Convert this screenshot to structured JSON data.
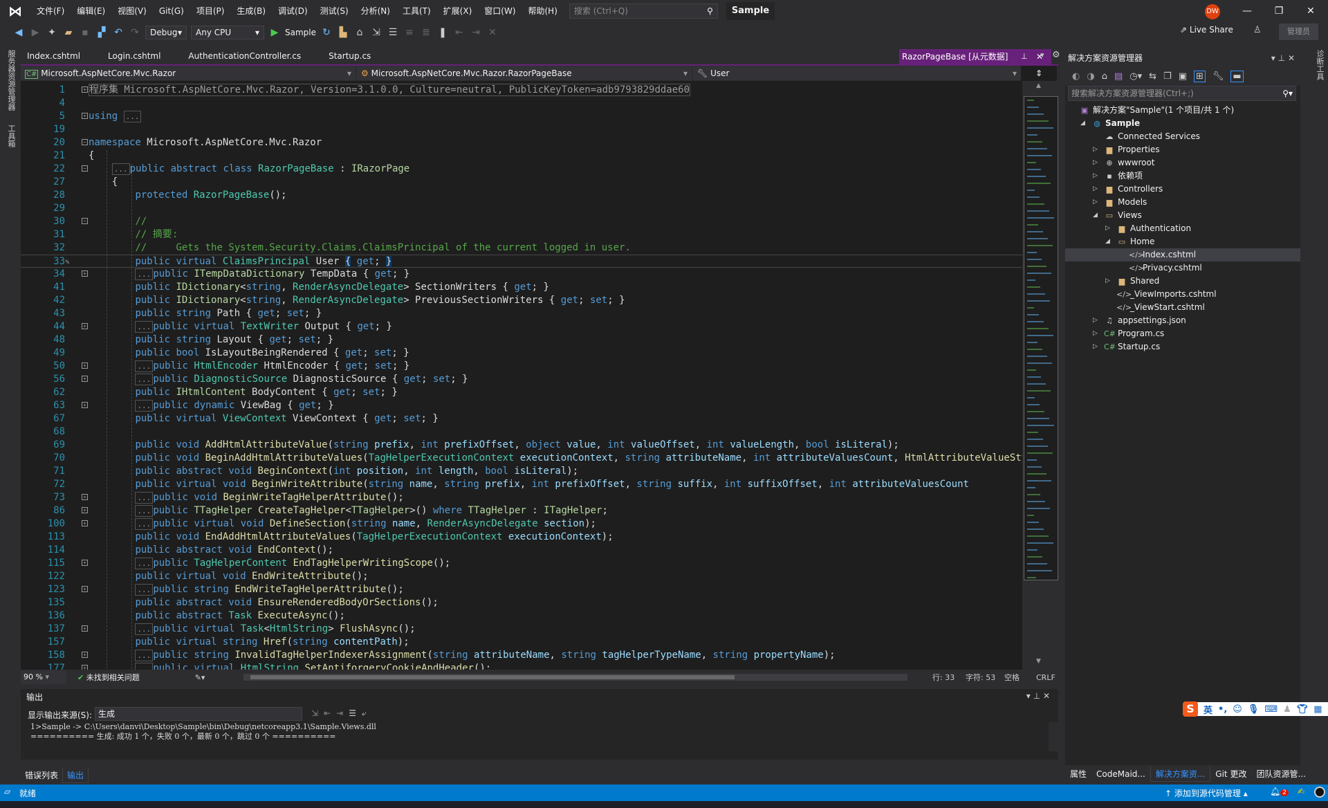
{
  "titlebar": {
    "menus": [
      "文件(F)",
      "编辑(E)",
      "视图(V)",
      "Git(G)",
      "项目(P)",
      "生成(B)",
      "调试(D)",
      "测试(S)",
      "分析(N)",
      "工具(T)",
      "扩展(X)",
      "窗口(W)",
      "帮助(H)"
    ],
    "search_placeholder": "搜索 (Ctrl+Q)",
    "solution_name": "Sample",
    "avatar_initials": "DW",
    "minimize": "—",
    "restore": "❐",
    "close": "✕"
  },
  "toolbar": {
    "configuration": "Debug",
    "platform": "Any CPU",
    "run_target": "Sample",
    "live_share": "Live Share",
    "admin_badge": "管理员"
  },
  "left_strip": {
    "tabs": [
      "服务器资源管理器",
      "工具箱"
    ]
  },
  "right_strip": {
    "tabs": [
      "诊断工具"
    ]
  },
  "editor": {
    "tabs": [
      "Index.cshtml",
      "Login.cshtml",
      "AuthenticationController.cs",
      "Startup.cs"
    ],
    "active_tab": "RazorPageBase [从元数据]",
    "nav": {
      "project": "Microsoft.AspNetCore.Mvc.Razor",
      "type": "Microsoft.AspNetCore.Mvc.Razor.RazorPageBase",
      "member": "User"
    },
    "lines": [
      {
        "n": "1",
        "fold": "+",
        "html": "<span class='gr' style='border:1px solid #555'>程序集 Microsoft.AspNetCore.Mvc.Razor, Version=3.1.0.0, Culture=neutral, PublicKeyToken=adb9793829ddae60</span>"
      },
      {
        "n": "4",
        "html": ""
      },
      {
        "n": "5",
        "fold": "+",
        "html": "<span class='kw'>using</span> <span class='coll'>...</span>"
      },
      {
        "n": "19",
        "html": ""
      },
      {
        "n": "20",
        "fold": "-",
        "html": "<span class='kw'>namespace</span> <span class='tx'>Microsoft.AspNetCore.Mvc.Razor</span>"
      },
      {
        "n": "21",
        "html": "<span class='tx'>{</span>"
      },
      {
        "n": "22",
        "fold": "-",
        "html": "    <span class='coll'>...</span><span class='kw'>public abstract class</span> <span class='ty'>RazorPageBase</span> <span class='tx'>:</span> <span class='if'>IRazorPage</span>"
      },
      {
        "n": "27",
        "html": "    <span class='tx'>{</span>"
      },
      {
        "n": "28",
        "html": "        <span class='kw'>protected</span> <span class='ty'>RazorPageBase</span><span class='tx'>();</span>"
      },
      {
        "n": "29",
        "html": ""
      },
      {
        "n": "30",
        "fold": "-",
        "html": "        <span class='cm'>//</span>"
      },
      {
        "n": "31",
        "html": "        <span class='cm'>// 摘要:</span>"
      },
      {
        "n": "32",
        "html": "        <span class='cm'>//     Gets the System.Security.Claims.ClaimsPrincipal of the current logged in user.</span>"
      },
      {
        "n": "33",
        "current": true,
        "html": "        <span class='kw'>public virtual</span> <span class='ty'>ClaimsPrincipal</span> <span class='tx'>User</span> <span class='tx brace-hl'>{</span> <span class='kw'>get</span><span class='tx'>;</span> <span class='tx brace-hl'>}</span>"
      },
      {
        "n": "34",
        "fold": "+",
        "html": "        <span class='coll'>...</span><span class='kw'>public</span> <span class='if'>ITempDataDictionary</span> <span class='tx'>TempData { </span><span class='kw'>get</span><span class='tx'>; }</span>"
      },
      {
        "n": "41",
        "html": "        <span class='kw'>public</span> <span class='if'>IDictionary</span><span class='tx'>&lt;</span><span class='kw'>string</span><span class='tx'>, </span><span class='ty'>RenderAsyncDelegate</span><span class='tx'>&gt; SectionWriters { </span><span class='kw'>get</span><span class='tx'>; }</span>"
      },
      {
        "n": "42",
        "html": "        <span class='kw'>public</span> <span class='if'>IDictionary</span><span class='tx'>&lt;</span><span class='kw'>string</span><span class='tx'>, </span><span class='ty'>RenderAsyncDelegate</span><span class='tx'>&gt; PreviousSectionWriters { </span><span class='kw'>get</span><span class='tx'>; </span><span class='kw'>set</span><span class='tx'>; }</span>"
      },
      {
        "n": "43",
        "html": "        <span class='kw'>public string</span> <span class='tx'>Path { </span><span class='kw'>get</span><span class='tx'>; </span><span class='kw'>set</span><span class='tx'>; }</span>"
      },
      {
        "n": "44",
        "fold": "+",
        "html": "        <span class='coll'>...</span><span class='kw'>public virtual</span> <span class='ty'>TextWriter</span> <span class='tx'>Output { </span><span class='kw'>get</span><span class='tx'>; }</span>"
      },
      {
        "n": "48",
        "html": "        <span class='kw'>public string</span> <span class='tx'>Layout { </span><span class='kw'>get</span><span class='tx'>; </span><span class='kw'>set</span><span class='tx'>; }</span>"
      },
      {
        "n": "49",
        "html": "        <span class='kw'>public bool</span> <span class='tx'>IsLayoutBeingRendered { </span><span class='kw'>get</span><span class='tx'>; </span><span class='kw'>set</span><span class='tx'>; }</span>"
      },
      {
        "n": "50",
        "fold": "+",
        "html": "        <span class='coll'>...</span><span class='kw'>public</span> <span class='ty'>HtmlEncoder</span> <span class='tx'>HtmlEncoder { </span><span class='kw'>get</span><span class='tx'>; </span><span class='kw'>set</span><span class='tx'>; }</span>"
      },
      {
        "n": "56",
        "fold": "+",
        "html": "        <span class='coll'>...</span><span class='kw'>public</span> <span class='ty'>DiagnosticSource</span> <span class='tx'>DiagnosticSource { </span><span class='kw'>get</span><span class='tx'>; </span><span class='kw'>set</span><span class='tx'>; }</span>"
      },
      {
        "n": "62",
        "html": "        <span class='kw'>public</span> <span class='if'>IHtmlContent</span> <span class='tx'>BodyContent { </span><span class='kw'>get</span><span class='tx'>; </span><span class='kw'>set</span><span class='tx'>; }</span>"
      },
      {
        "n": "63",
        "fold": "+",
        "html": "        <span class='coll'>...</span><span class='kw'>public dynamic</span> <span class='tx'>ViewBag { </span><span class='kw'>get</span><span class='tx'>; }</span>"
      },
      {
        "n": "67",
        "html": "        <span class='kw'>public virtual</span> <span class='ty'>ViewContext</span> <span class='tx'>ViewContext { </span><span class='kw'>get</span><span class='tx'>; </span><span class='kw'>set</span><span class='tx'>; }</span>"
      },
      {
        "n": "68",
        "html": ""
      },
      {
        "n": "69",
        "html": "        <span class='kw'>public void</span> <span class='fn'>AddHtmlAttributeValue</span><span class='tx'>(</span><span class='kw'>string</span> <span class='pa'>prefix</span><span class='tx'>, </span><span class='kw'>int</span> <span class='pa'>prefixOffset</span><span class='tx'>, </span><span class='kw'>object</span> <span class='pa'>value</span><span class='tx'>, </span><span class='kw'>int</span> <span class='pa'>valueOffset</span><span class='tx'>, </span><span class='kw'>int</span> <span class='pa'>valueLength</span><span class='tx'>, </span><span class='kw'>bool</span> <span class='pa'>isLiteral</span><span class='tx'>);</span>"
      },
      {
        "n": "70",
        "html": "        <span class='kw'>public void</span> <span class='fn'>BeginAddHtmlAttributeValues</span><span class='tx'>(</span><span class='ty'>TagHelperExecutionContext</span> <span class='pa'>executionContext</span><span class='tx'>, </span><span class='kw'>string</span> <span class='pa'>attributeName</span><span class='tx'>, </span><span class='kw'>int</span> <span class='pa'>attributeValuesCount</span><span class='tx'>, </span><span class='fn'>HtmlAttributeValueStyle</span>"
      },
      {
        "n": "71",
        "html": "        <span class='kw'>public abstract void</span> <span class='fn'>BeginContext</span><span class='tx'>(</span><span class='kw'>int</span> <span class='pa'>position</span><span class='tx'>, </span><span class='kw'>int</span> <span class='pa'>length</span><span class='tx'>, </span><span class='kw'>bool</span> <span class='pa'>isLiteral</span><span class='tx'>);</span>"
      },
      {
        "n": "72",
        "html": "        <span class='kw'>public virtual void</span> <span class='fn'>BeginWriteAttribute</span><span class='tx'>(</span><span class='kw'>string</span> <span class='pa'>name</span><span class='tx'>, </span><span class='kw'>string</span> <span class='pa'>prefix</span><span class='tx'>, </span><span class='kw'>int</span> <span class='pa'>prefixOffset</span><span class='tx'>, </span><span class='kw'>string</span> <span class='pa'>suffix</span><span class='tx'>, </span><span class='kw'>int</span> <span class='pa'>suffixOffset</span><span class='tx'>, </span><span class='kw'>int</span> <span class='pa'>attributeValuesCount</span>"
      },
      {
        "n": "73",
        "fold": "+",
        "html": "        <span class='coll'>...</span><span class='kw'>public void</span> <span class='fn'>BeginWriteTagHelperAttribute</span><span class='tx'>();</span>"
      },
      {
        "n": "86",
        "fold": "+",
        "html": "        <span class='coll'>...</span><span class='kw'>public</span> <span class='if'>TTagHelper</span> <span class='fn'>CreateTagHelper</span><span class='tx'>&lt;</span><span class='if'>TTagHelper</span><span class='tx'>&gt;() </span><span class='kw'>where</span> <span class='if'>TTagHelper</span> <span class='tx'>:</span> <span class='if'>ITagHelper</span><span class='tx'>;</span>"
      },
      {
        "n": "100",
        "fold": "+",
        "html": "        <span class='coll'>...</span><span class='kw'>public virtual void</span> <span class='fn'>DefineSection</span><span class='tx'>(</span><span class='kw'>string</span> <span class='pa'>name</span><span class='tx'>, </span><span class='ty'>RenderAsyncDelegate</span> <span class='pa'>section</span><span class='tx'>);</span>"
      },
      {
        "n": "113",
        "html": "        <span class='kw'>public void</span> <span class='fn'>EndAddHtmlAttributeValues</span><span class='tx'>(</span><span class='ty'>TagHelperExecutionContext</span> <span class='pa'>executionContext</span><span class='tx'>);</span>"
      },
      {
        "n": "114",
        "html": "        <span class='kw'>public abstract void</span> <span class='fn'>EndContext</span><span class='tx'>();</span>"
      },
      {
        "n": "115",
        "fold": "+",
        "html": "        <span class='coll'>...</span><span class='kw'>public</span> <span class='ty'>TagHelperContent</span> <span class='fn'>EndTagHelperWritingScope</span><span class='tx'>();</span>"
      },
      {
        "n": "122",
        "html": "        <span class='kw'>public virtual void</span> <span class='fn'>EndWriteAttribute</span><span class='tx'>();</span>"
      },
      {
        "n": "123",
        "fold": "+",
        "html": "        <span class='coll'>...</span><span class='kw'>public string</span> <span class='fn'>EndWriteTagHelperAttribute</span><span class='tx'>();</span>"
      },
      {
        "n": "135",
        "html": "        <span class='kw'>public abstract void</span> <span class='fn'>EnsureRenderedBodyOrSections</span><span class='tx'>();</span>"
      },
      {
        "n": "136",
        "html": "        <span class='kw'>public abstract</span> <span class='ty'>Task</span> <span class='fn'>ExecuteAsync</span><span class='tx'>();</span>"
      },
      {
        "n": "137",
        "fold": "+",
        "html": "        <span class='coll'>...</span><span class='kw'>public virtual</span> <span class='ty'>Task</span><span class='tx'>&lt;</span><span class='ty'>HtmlString</span><span class='tx'>&gt; </span><span class='fn'>FlushAsync</span><span class='tx'>();</span>"
      },
      {
        "n": "157",
        "html": "        <span class='kw'>public virtual string</span> <span class='fn'>Href</span><span class='tx'>(</span><span class='kw'>string</span> <span class='pa'>contentPath</span><span class='tx'>);</span>"
      },
      {
        "n": "158",
        "fold": "+",
        "html": "        <span class='coll'>...</span><span class='kw'>public string</span> <span class='fn'>InvalidTagHelperIndexerAssignment</span><span class='tx'>(</span><span class='kw'>string</span> <span class='pa'>attributeName</span><span class='tx'>, </span><span class='kw'>string</span> <span class='pa'>tagHelperTypeName</span><span class='tx'>, </span><span class='kw'>string</span> <span class='pa'>propertyName</span><span class='tx'>);</span>"
      },
      {
        "n": "177",
        "fold": "+",
        "html": "        <span class='coll'>...</span><span class='kw'>public virtual</span> <span class='ty'>HtmlString</span> <span class='fn'>SetAntiforgeryCookieAndHeader</span><span class='tx'>();</span>"
      }
    ],
    "status": {
      "zoom": "90 %",
      "issues": "未找到相关问题",
      "line": "行: 33",
      "char": "字符: 53",
      "indent": "空格",
      "eol": "CRLF"
    }
  },
  "output": {
    "title": "输出",
    "source_label": "显示输出来源(S):",
    "source_value": "生成",
    "lines": [
      "1>Sample -> C:\\Users\\danvi\\Desktop\\Sample\\bin\\Debug\\netcoreapp3.1\\Sample.Views.dll",
      "========== 生成: 成功 1 个，失败 0 个，最新 0 个，跳过 0 个 =========="
    ],
    "tabs": [
      "错误列表",
      "输出"
    ],
    "active_tab": "输出"
  },
  "solution_explorer": {
    "title": "解决方案资源管理器",
    "search_placeholder": "搜索解决方案资源管理器(Ctrl+;)",
    "tree": [
      {
        "label": "解决方案\"Sample\"(1 个项目/共 1 个)",
        "depth": 0,
        "icon": "solution-icon",
        "glyph": "▣",
        "arrow": "",
        "color": "#b180d7"
      },
      {
        "label": "Sample",
        "depth": 1,
        "icon": "web-project-icon",
        "glyph": "◍",
        "arrow": "◢",
        "bold": true,
        "color": "#3c9bd8"
      },
      {
        "label": "Connected Services",
        "depth": 2,
        "icon": "connected-services-icon",
        "glyph": "☁",
        "arrow": "",
        "color": "#ccc"
      },
      {
        "label": "Properties",
        "depth": 2,
        "icon": "properties-icon",
        "glyph": "▆",
        "arrow": "▷",
        "color": "#dcb67a"
      },
      {
        "label": "wwwroot",
        "depth": 2,
        "icon": "globe-icon",
        "glyph": "⊕",
        "arrow": "▷",
        "color": "#ccc"
      },
      {
        "label": "依赖项",
        "depth": 2,
        "icon": "dependencies-icon",
        "glyph": "▪",
        "arrow": "▷",
        "color": "#ccc"
      },
      {
        "label": "Controllers",
        "depth": 2,
        "icon": "folder-icon",
        "glyph": "▆",
        "arrow": "▷",
        "color": "#dcb67a"
      },
      {
        "label": "Models",
        "depth": 2,
        "icon": "folder-icon",
        "glyph": "▆",
        "arrow": "▷",
        "color": "#dcb67a"
      },
      {
        "label": "Views",
        "depth": 2,
        "icon": "folder-open-icon",
        "glyph": "▭",
        "arrow": "◢",
        "color": "#dcb67a"
      },
      {
        "label": "Authentication",
        "depth": 3,
        "icon": "folder-icon",
        "glyph": "▆",
        "arrow": "▷",
        "color": "#dcb67a"
      },
      {
        "label": "Home",
        "depth": 3,
        "icon": "folder-open-icon",
        "glyph": "▭",
        "arrow": "◢",
        "color": "#dcb67a"
      },
      {
        "label": "Index.cshtml",
        "depth": 4,
        "icon": "razor-file-icon",
        "glyph": "</>",
        "arrow": "",
        "selected": true,
        "color": "#ccc"
      },
      {
        "label": "Privacy.cshtml",
        "depth": 4,
        "icon": "razor-file-icon",
        "glyph": "</>",
        "arrow": "",
        "color": "#ccc"
      },
      {
        "label": "Shared",
        "depth": 3,
        "icon": "folder-icon",
        "glyph": "▆",
        "arrow": "▷",
        "color": "#dcb67a"
      },
      {
        "label": "_ViewImports.cshtml",
        "depth": 3,
        "icon": "razor-file-icon",
        "glyph": "</>",
        "arrow": "",
        "color": "#ccc"
      },
      {
        "label": "_ViewStart.cshtml",
        "depth": 3,
        "icon": "razor-file-icon",
        "glyph": "</>",
        "arrow": "",
        "color": "#ccc"
      },
      {
        "label": "appsettings.json",
        "depth": 2,
        "icon": "json-file-icon",
        "glyph": "♫",
        "arrow": "▷",
        "color": "#ccc"
      },
      {
        "label": "Program.cs",
        "depth": 2,
        "icon": "csharp-file-icon",
        "glyph": "C#",
        "arrow": "▷",
        "color": "#6fbf73"
      },
      {
        "label": "Startup.cs",
        "depth": 2,
        "icon": "csharp-file-icon",
        "glyph": "C#",
        "arrow": "▷",
        "color": "#6fbf73"
      }
    ],
    "bottom_tabs": [
      "属性",
      "CodeMaid...",
      "解决方案资...",
      "Git 更改",
      "团队资源管..."
    ],
    "active_bottom_tab": "解决方案资..."
  },
  "statusbar": {
    "ready": "就绪",
    "source_control": "添加到源代码管理",
    "notifications_count": "2"
  },
  "ime": {
    "mode": "英"
  },
  "colors": {
    "accent": "#007acc",
    "tab_active": "#68217a",
    "avatar": "#e0410e"
  }
}
